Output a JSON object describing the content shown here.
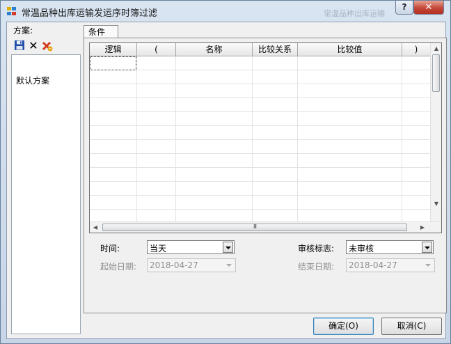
{
  "window": {
    "title": "常温品种出库运输发运序时簿过滤",
    "help_glyph": "?",
    "close_glyph": "✕",
    "background_overlap_text": "常温品种出库运输"
  },
  "scheme": {
    "label": "方案:",
    "toolbar": {
      "save_icon": "save-icon",
      "delete_glyph": "✕",
      "delete_icon": "delete-icon",
      "clear_icon": "clear-icon"
    },
    "items": [
      "默认方案"
    ]
  },
  "tabs": [
    {
      "label": "条件"
    }
  ],
  "grid": {
    "columns": [
      "逻辑",
      "(",
      "名称",
      "比较关系",
      "比较值",
      ")"
    ],
    "hscroll_grip": "III",
    "scroll_up_glyph": "▲",
    "scroll_down_glyph": "▼",
    "scroll_left_glyph": "◀",
    "scroll_right_glyph": "▶"
  },
  "filters": {
    "time_label": "时间:",
    "time_value": "当天",
    "audit_label": "审核标志:",
    "audit_value": "未审核",
    "start_date_label": "起始日期:",
    "start_date_value": "2018-04-27",
    "end_date_label": "结束日期:",
    "end_date_value": "2018-04-27"
  },
  "buttons": {
    "ok": "确定(O)",
    "cancel": "取消(C)"
  },
  "colors": {
    "titlebar": "#c7d5e7",
    "close_button": "#c4483a",
    "client_bg": "#f0f0f0"
  }
}
